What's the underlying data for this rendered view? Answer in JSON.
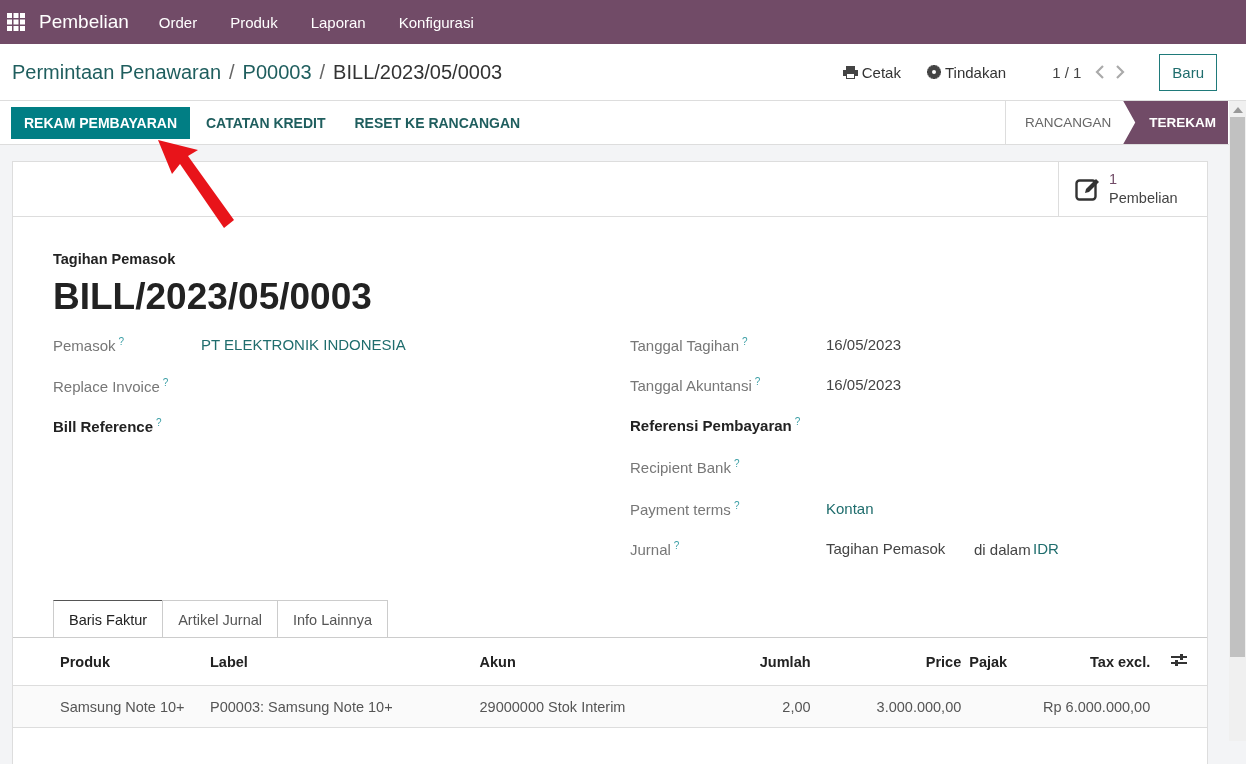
{
  "navbar": {
    "app": "Pembelian",
    "menus": [
      "Order",
      "Produk",
      "Laporan",
      "Konfigurasi"
    ]
  },
  "breadcrumb": {
    "parents": [
      "Permintaan Penawaran",
      "P00003"
    ],
    "separators": [
      "/",
      "/"
    ],
    "current": "BILL/2023/05/0003"
  },
  "actions": {
    "print": "Cetak",
    "action": "Tindakan",
    "pager": "1 / 1",
    "new": "Baru"
  },
  "buttons": [
    {
      "label": "REKAM PEMBAYARAN",
      "primary": true
    },
    {
      "label": "CATATAN KREDIT",
      "primary": false
    },
    {
      "label": "RESET KE RANCANGAN",
      "primary": false
    }
  ],
  "stages": [
    {
      "label": "RANCANGAN",
      "selected": false
    },
    {
      "label": "TEREKAM",
      "selected": true
    }
  ],
  "smart_button": {
    "count": "1",
    "label": "Pembelian"
  },
  "form": {
    "subtitle": "Tagihan Pemasok",
    "title": "BILL/2023/05/0003",
    "help": "?",
    "left": [
      {
        "label": "Pemasok",
        "required": false,
        "values": [
          {
            "text": "PT ELEKTRONIK INDONESIA",
            "link": true
          }
        ]
      },
      {
        "label": "Replace Invoice",
        "required": false
      },
      {
        "label": "Bill Reference",
        "required": true
      }
    ],
    "right": [
      {
        "label": "Tanggal Tagihan",
        "required": false,
        "values": [
          {
            "text": "16/05/2023",
            "link": false
          }
        ]
      },
      {
        "label": "Tanggal Akuntansi",
        "required": false,
        "values": [
          {
            "text": "16/05/2023",
            "link": false
          }
        ]
      },
      {
        "label": "Referensi Pembayaran",
        "required": true
      },
      {
        "label": "Recipient Bank",
        "required": false
      },
      {
        "label": "Payment terms",
        "required": false,
        "values": [
          {
            "text": "Kontan",
            "link": true
          }
        ]
      },
      {
        "label": "Jurnal",
        "required": false,
        "values": [
          {
            "text": "Tagihan Pemasok",
            "link": false
          },
          {
            "text": "di dalam",
            "link": false
          },
          {
            "text": "IDR",
            "link": true
          }
        ]
      }
    ]
  },
  "tabs": [
    {
      "label": "Baris Faktur",
      "selected": true
    },
    {
      "label": "Artikel Jurnal",
      "selected": false
    },
    {
      "label": "Info Lainnya",
      "selected": false
    }
  ],
  "table": {
    "columns": [
      "Produk",
      "Label",
      "Akun",
      "Jumlah",
      "Price",
      "Pajak",
      "Tax excl."
    ],
    "rows": [
      [
        "Samsung Note 10+",
        "P00003: Samsung Note 10+",
        "29000000 Stok Interim",
        "2,00",
        "3.000.000,00",
        "",
        "Rp 6.000.000,00"
      ]
    ]
  }
}
